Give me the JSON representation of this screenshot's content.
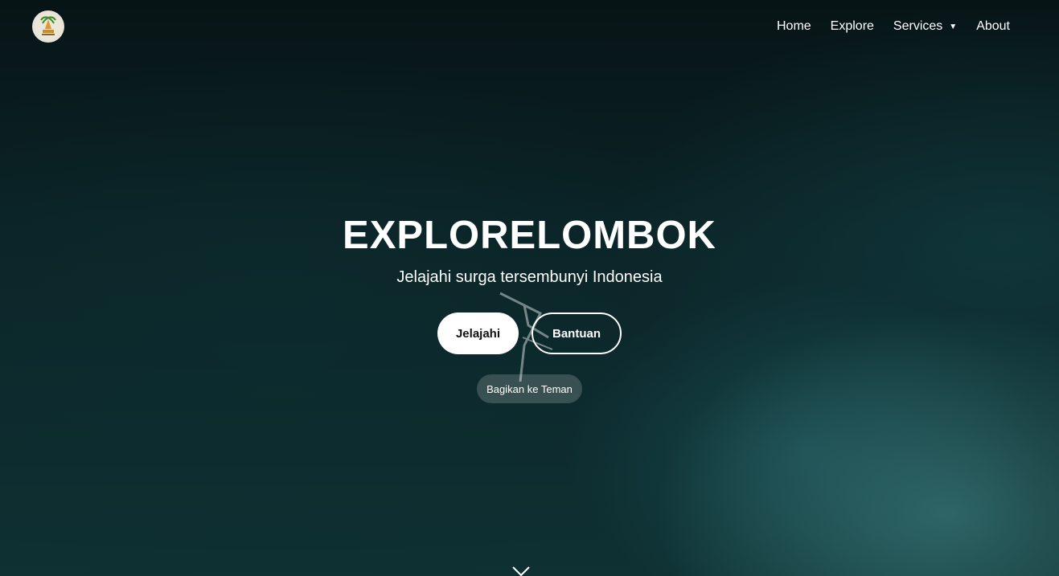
{
  "nav": {
    "logo_icon": "explore-lombok-logo",
    "links": [
      {
        "label": "Home"
      },
      {
        "label": "Explore"
      },
      {
        "label": "Services",
        "caret": "▼"
      },
      {
        "label": "About"
      }
    ]
  },
  "hero": {
    "title": "EXPLORELOMBOK",
    "subtitle": "Jelajahi surga tersembunyi Indonesia",
    "primary_button": "Jelajahi",
    "secondary_button": "Bantuan",
    "share_button": "Bagikan ke Teman"
  },
  "scroll": {
    "icon": "chevron-down-icon"
  },
  "colors": {
    "primary_button_bg": "#ffffff",
    "text": "#ffffff",
    "background": "#0b2326"
  }
}
